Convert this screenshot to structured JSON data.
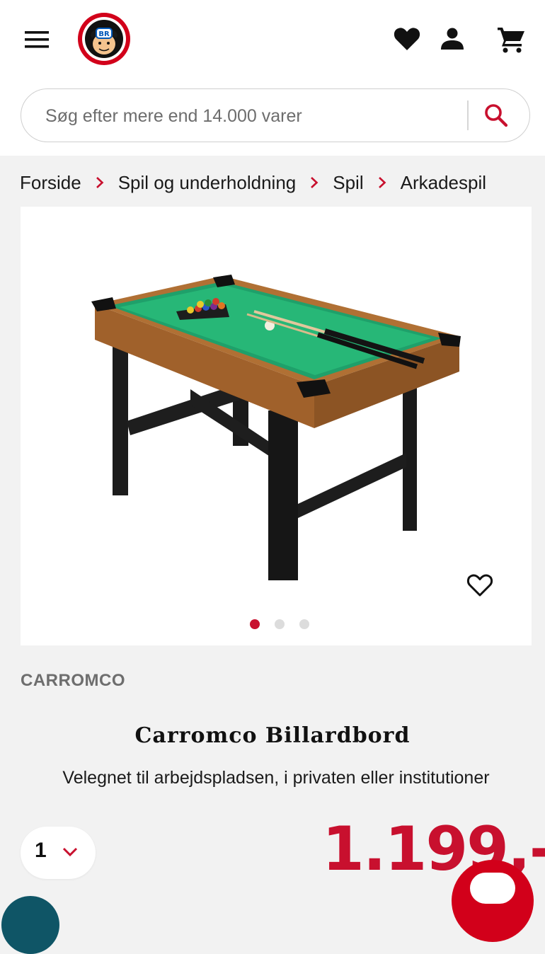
{
  "header": {
    "menu_icon": "hamburger-menu-icon",
    "logo_text": "BR",
    "wishlist_icon": "heart-icon",
    "account_icon": "user-icon",
    "cart_icon": "shopping-cart-icon"
  },
  "search": {
    "placeholder": "Søg efter mere end 14.000 varer",
    "icon": "search-icon"
  },
  "breadcrumb": [
    "Forside",
    "Spil og underholdning",
    "Spil",
    "Arkadespil"
  ],
  "gallery": {
    "image_alt": "Carromco Billardbord",
    "slide_count": 3,
    "active_slide": 1,
    "wishlist_icon": "heart-outline-icon"
  },
  "product": {
    "brand": "CARROMCO",
    "title": "Carromco Billardbord",
    "subtitle": "Velegnet til arbejdspladsen, i privaten eller institutioner",
    "quantity": "1",
    "price": "1.199,-"
  },
  "colors": {
    "accent": "#c8102e",
    "background": "#f2f2f2",
    "teal": "#0f5566"
  }
}
